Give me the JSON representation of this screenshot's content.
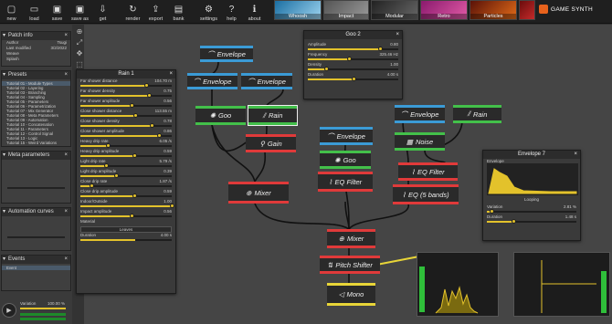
{
  "toolbar": {
    "buttons": [
      {
        "label": "new",
        "icon": "new-icon"
      },
      {
        "label": "load",
        "icon": "folder-icon"
      },
      {
        "label": "save",
        "icon": "save-icon"
      },
      {
        "label": "save as",
        "icon": "save-as-icon"
      },
      {
        "label": "get",
        "icon": "download-icon"
      },
      {
        "label": "render",
        "icon": "render-icon"
      },
      {
        "label": "export",
        "icon": "export-icon"
      },
      {
        "label": "bank",
        "icon": "bank-icon"
      },
      {
        "label": "settings",
        "icon": "gear-icon"
      },
      {
        "label": "help",
        "icon": "help-icon"
      },
      {
        "label": "about",
        "icon": "info-icon"
      }
    ],
    "thumbnails": [
      "Whoosh",
      "Impact",
      "Modular",
      "Retro",
      "Particles"
    ],
    "logo_text": "GAME SYNTH"
  },
  "patch_info": {
    "title": "Patch info",
    "rows": [
      {
        "label": "Author",
        "value": "Tsugi"
      },
      {
        "label": "Last modified",
        "value": "3/2/2022"
      },
      {
        "label": "Weave",
        "value": ""
      },
      {
        "label": "Splash",
        "value": ""
      }
    ]
  },
  "presets": {
    "title": "Presets",
    "items": [
      "Tutorial 01 - Module Types",
      "Tutorial 02 - Layering",
      "Tutorial 03 - Branching",
      "Tutorial 04 - Sampling",
      "Tutorial 05 - Parameters",
      "Tutorial 06 - Parametrization",
      "Tutorial 07 - Mix Generator",
      "Tutorial 08 - Meta Parameters",
      "Tutorial 09 - Automation",
      "Tutorial 10 - Concatenation",
      "Tutorial 11 - Parameters",
      "Tutorial 12 - Control Signal",
      "Tutorial 13 - Logic",
      "Tutorial 15 - Weird Variations"
    ]
  },
  "meta_parameters": {
    "title": "Meta parameters"
  },
  "automation_curves": {
    "title": "Automation curves"
  },
  "events": {
    "title": "Events",
    "items": [
      "Event",
      "Event"
    ]
  },
  "variation": {
    "label": "Variation",
    "value": "100.00 %"
  },
  "nodes": {
    "envelope_top": "Envelope",
    "envelope_a": "Envelope",
    "envelope_b": "Envelope",
    "goo_a": "Goo",
    "rain": "Rain",
    "gain": "Gain",
    "mixer_a": "Mixer",
    "envelope_c": "Envelope",
    "goo_b": "Goo",
    "eq_filter_a": "EQ Filter",
    "envelope_d": "Envelope",
    "rain_b": "Rain",
    "noise": "Noise",
    "eq_filter_b": "EQ Filter",
    "eq5": "EQ (5 bands)",
    "mixer_b": "Mixer",
    "pitch": "Pitch Shifter",
    "mono": "Mono"
  },
  "rain_window": {
    "title": "Rain 1",
    "params": [
      {
        "label": "Far shower distance",
        "value": "104.70 m",
        "fill": 0.72
      },
      {
        "label": "Far shower density",
        "value": "0.75",
        "fill": 0.75
      },
      {
        "label": "Far shower amplitude",
        "value": "0.56",
        "fill": 0.56
      },
      {
        "label": "Close shower distance",
        "value": "113.55 m",
        "fill": 0.6
      },
      {
        "label": "Close shower density",
        "value": "0.78",
        "fill": 0.78
      },
      {
        "label": "Close shower amplitude",
        "value": "0.86",
        "fill": 0.86
      },
      {
        "label": "Heavy drip rate",
        "value": "6.05 /s",
        "fill": 0.3
      },
      {
        "label": "Heavy drip amplitude",
        "value": "0.59",
        "fill": 0.59
      },
      {
        "label": "Light drip rate",
        "value": "5.79 /s",
        "fill": 0.28
      },
      {
        "label": "Light drip amplitude",
        "value": "0.39",
        "fill": 0.39
      },
      {
        "label": "Close drip rate",
        "value": "1.87 /s",
        "fill": 0.12
      },
      {
        "label": "Close drip amplitude",
        "value": "0.59",
        "fill": 0.59
      },
      {
        "label": "Indoor/Outside",
        "value": "1.00",
        "fill": 1.0
      },
      {
        "label": "Impact amplitude",
        "value": "0.56",
        "fill": 0.56
      }
    ],
    "material_label": "Material",
    "material_value": "Leaves",
    "duration_label": "Duration",
    "duration_value": "4.00 s"
  },
  "goo_window": {
    "title": "Goo 2",
    "params": [
      {
        "label": "Amplitude",
        "value": "0.80",
        "fill": 0.8
      },
      {
        "label": "Frequency",
        "value": "325.46 Hz",
        "fill": 0.45
      },
      {
        "label": "Density",
        "value": "1.00",
        "fill": 0.2
      },
      {
        "label": "Duration",
        "value": "4.00 s",
        "fill": 0.5
      }
    ]
  },
  "envelope_window": {
    "title": "Envelope 7",
    "section": "Envelope",
    "looping": "Looping",
    "params": [
      {
        "label": "Variation",
        "value": "2.81 %",
        "fill": 0.05
      },
      {
        "label": "Duration",
        "value": "1.48 s",
        "fill": 0.3
      }
    ]
  }
}
